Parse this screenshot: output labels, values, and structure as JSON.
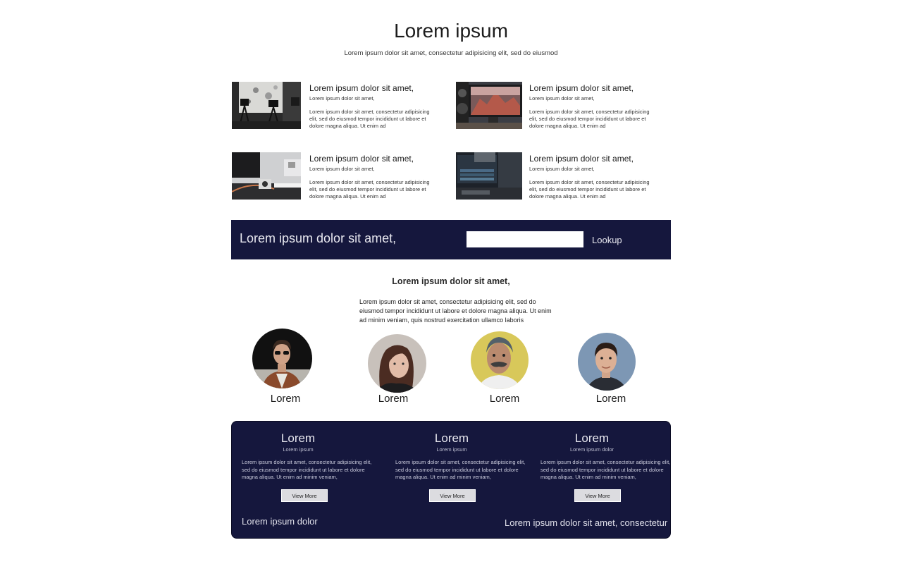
{
  "header": {
    "title": "Lorem ipsum",
    "subtitle": "Lorem ipsum dolor sit amet, consectetur adipisicing elit, sed do eiusmod"
  },
  "features": [
    {
      "title": "Lorem ipsum dolor sit amet,",
      "subtitle": "Lorem ipsum dolor sit amet,",
      "body": "Lorem ipsum dolor sit amet, consectetur adipisicing elit, sed do eiusmod tempor incididunt ut labore et dolore magna aliqua. Ut enim ad",
      "image": "camera-studio-photo"
    },
    {
      "title": "Lorem ipsum dolor sit amet,",
      "subtitle": "Lorem ipsum dolor sit amet,",
      "body": "Lorem ipsum dolor sit amet, consectetur adipisicing elit, sed do eiusmod tempor incididunt ut labore et dolore magna aliqua. Ut enim ad",
      "image": "desktop-monitor-photo"
    },
    {
      "title": "Lorem ipsum dolor sit amet,",
      "subtitle": "Lorem ipsum dolor sit amet,",
      "body": "Lorem ipsum dolor sit amet, consectetur adipisicing elit, sed do eiusmod tempor incididunt ut labore et dolore magna aliqua. Ut enim ad",
      "image": "desk-camera-photo"
    },
    {
      "title": "Lorem ipsum dolor sit amet,",
      "subtitle": "Lorem ipsum dolor sit amet,",
      "body": "Lorem ipsum dolor sit amet, consectetur adipisicing elit, sed do eiusmod tempor incididunt ut labore et dolore magna aliqua. Ut enim ad",
      "image": "editing-workstation-photo"
    }
  ],
  "lookup": {
    "text": "Lorem ipsum dolor sit amet,",
    "input_value": "",
    "button_label": "Lookup"
  },
  "team": {
    "title": "Lorem ipsum dolor sit amet,",
    "body": "Lorem ipsum dolor sit amet, consectetur adipisicing elit, sed do eiusmod tempor incididunt ut labore et dolore magna aliqua. Ut enim ad minim veniam, quis nostrud exercitation ullamco laboris",
    "members": [
      {
        "name": "Lorem",
        "photo": "man-sunglasses-portrait"
      },
      {
        "name": "Lorem",
        "photo": "woman-portrait"
      },
      {
        "name": "Lorem",
        "photo": "older-man-portrait"
      },
      {
        "name": "Lorem",
        "photo": "young-man-portrait"
      }
    ]
  },
  "cards": {
    "items": [
      {
        "title": "Lorem",
        "subtitle": "Lorem ipsum",
        "body": "Lorem ipsum dolor sit amet, consectetur adipisicing elit, sed do eiusmod tempor incididunt ut labore et dolore magna aliqua. Ut enim ad minim veniam,",
        "button_label": "View More"
      },
      {
        "title": "Lorem",
        "subtitle": "Lorem ipsum",
        "body": "Lorem ipsum dolor sit amet, consectetur adipisicing elit, sed do eiusmod tempor incididunt ut labore et dolore magna aliqua. Ut enim ad minim veniam,",
        "button_label": "View More"
      },
      {
        "title": "Lorem",
        "subtitle": "Lorem ipsum dolor",
        "body": "Lorem ipsum dolor sit amet, consectetur adipisicing elit, sed do eiusmod tempor incididunt ut labore et dolore magna aliqua. Ut enim ad minim veniam,",
        "button_label": "View More"
      }
    ],
    "footer_left": "Lorem ipsum dolor",
    "footer_right": "Lorem ipsum dolor sit amet, consectetur"
  },
  "colors": {
    "navy": "#15173d",
    "button_bg": "#dcdce0",
    "text_dark": "#1c1c1c"
  }
}
